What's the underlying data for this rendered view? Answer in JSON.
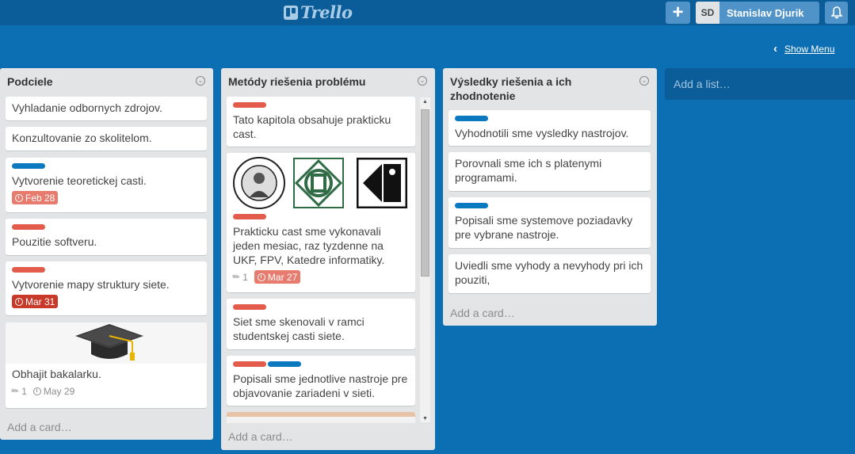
{
  "header": {
    "logo_text": "Trello",
    "add_label": "+",
    "user_initials": "SD",
    "user_name": "Stanislav Djurik"
  },
  "board": {
    "show_menu_label": "Show Menu",
    "add_list_placeholder": "Add a list…"
  },
  "lists": [
    {
      "title": "Podciele",
      "add_card_label": "Add a card…",
      "cards": [
        {
          "title": "Vyhladanie odbornych zdrojov."
        },
        {
          "title": "Konzultovanie zo skolitelom."
        },
        {
          "title": "Vytvorenie teoretickej casti.",
          "labels": [
            "blue"
          ],
          "due": "Feb 28"
        },
        {
          "title": "Pouzitie softveru.",
          "labels": [
            "red"
          ]
        },
        {
          "title": "Vytvorenie mapy struktury siete.",
          "labels": [
            "red"
          ],
          "due": "Mar 31"
        },
        {
          "title": "Obhajit bakalarku.",
          "cover": "graduation-cap",
          "attachments": "1",
          "due": "May 29"
        }
      ]
    },
    {
      "title": "Metódy riešenia problému",
      "add_card_label": "Add a card…",
      "cards": [
        {
          "title": "Tato kapitola obsahuje prakticku cast.",
          "labels": [
            "red"
          ]
        },
        {
          "title": "Prakticku cast sme vykonavali jeden mesiac, raz tyzdenne na UKF, FPV, Katedre informatiky.",
          "cover": "university-logos",
          "labels": [
            "red"
          ],
          "attachments": "1",
          "due": "Mar 27"
        },
        {
          "title": "Siet sme skenovali v ramci studentskej casti siete.",
          "labels": [
            "red"
          ]
        },
        {
          "title": "Popisali sme jednotlive nastroje pre objavovanie zariadeni v sieti.",
          "labels": [
            "red",
            "blue"
          ]
        }
      ]
    },
    {
      "title": "Výsledky riešenia a ich zhodnotenie",
      "add_card_label": "Add a card…",
      "cards": [
        {
          "title": "Vyhodnotili sme vysledky nastrojov.",
          "labels": [
            "blue"
          ]
        },
        {
          "title": "Porovnali sme ich s platenymi programami."
        },
        {
          "title": "Popisali sme systemove poziadavky pre vybrane nastroje.",
          "labels": [
            "blue"
          ]
        },
        {
          "title": "Uviedli sme vyhody a nevyhody pri ich pouziti,"
        }
      ]
    }
  ],
  "colors": {
    "board": "#0c6fb3",
    "header": "#0a5d98",
    "label_red": "#e25b4b",
    "label_blue": "#0b79bf"
  }
}
